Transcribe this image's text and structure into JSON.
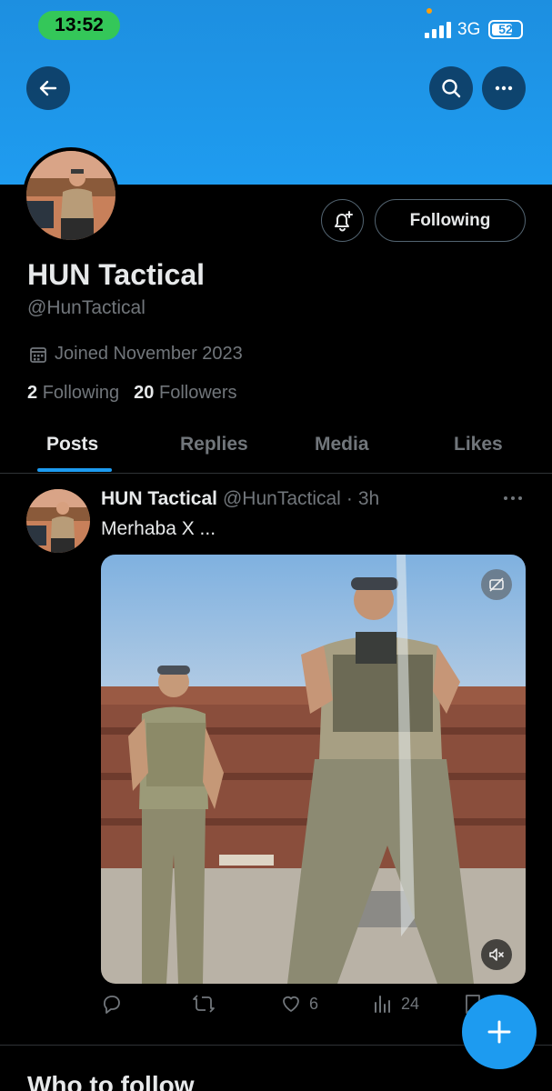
{
  "status_bar": {
    "time": "13:52",
    "network": "3G",
    "battery": "52"
  },
  "profile": {
    "name": "HUN Tactical",
    "handle": "@HunTactical",
    "joined": "Joined November 2023",
    "following_count": "2",
    "following_label": "Following",
    "followers_count": "20",
    "followers_label": "Followers",
    "follow_button_label": "Following"
  },
  "tabs": [
    "Posts",
    "Replies",
    "Media",
    "Likes"
  ],
  "active_tab": "Posts",
  "post": {
    "author_name": "HUN Tactical",
    "author_handle": "@HunTactical",
    "separator": "·",
    "age": "3h",
    "text": "Merhaba X ...",
    "likes": "6",
    "views": "24"
  },
  "section_heading": "Who to follow",
  "colors": {
    "accent": "#1d9bf0",
    "banner": "#1f9cf0",
    "background": "#000000",
    "muted": "#71767b"
  },
  "icons": [
    "back-arrow-icon",
    "search-icon",
    "more-icon",
    "bell-plus-icon",
    "calendar-icon",
    "captions-icon",
    "muted-speaker-icon",
    "reply-icon",
    "repost-icon",
    "like-icon",
    "views-icon",
    "bookmark-icon",
    "plus-icon"
  ]
}
